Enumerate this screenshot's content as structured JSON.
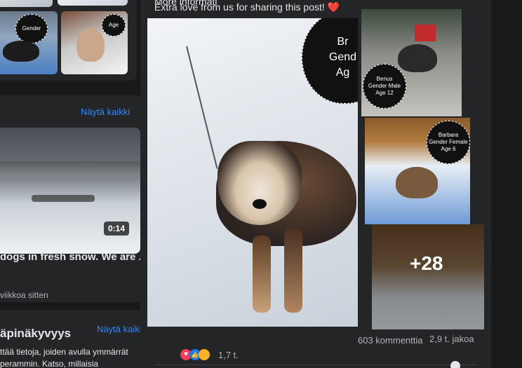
{
  "post": {
    "header_cut": "More informati",
    "caption": "Extra love from us for sharing this post!",
    "heart": "❤️",
    "more_count": "+28",
    "reactions": "1,7 t.",
    "comments": "603 kommenttia",
    "shares": "2,9 t. jakoa",
    "badge_main": [
      "Br",
      "Gend",
      "Ag"
    ],
    "badge_small1": [
      "Benus",
      "Gender Male",
      "Age 12"
    ],
    "badge_small2": [
      "Barbara",
      "Gender Female",
      "Age 6"
    ]
  },
  "left": {
    "videos": {
      "see_all": "Näytä kaikki",
      "duration": "0:14",
      "title": "dogs in fresh snow. We are ...",
      "time": "viikkoa sitten"
    },
    "transparency": {
      "title": "äpinäkyvyys",
      "see_all": "Näytä kaikki",
      "line1": "ttää tietoja, joiden avulla ymmärrät",
      "line2": "perammin. Katso, millaisia"
    },
    "tile_badge": [
      "Gender",
      "Age"
    ]
  },
  "colors": {
    "accent": "#2d88ff",
    "card": "#242526",
    "bg": "#18191a"
  },
  "icons": [
    "heart-reaction-icon",
    "like-reaction-icon",
    "care-reaction-icon"
  ]
}
